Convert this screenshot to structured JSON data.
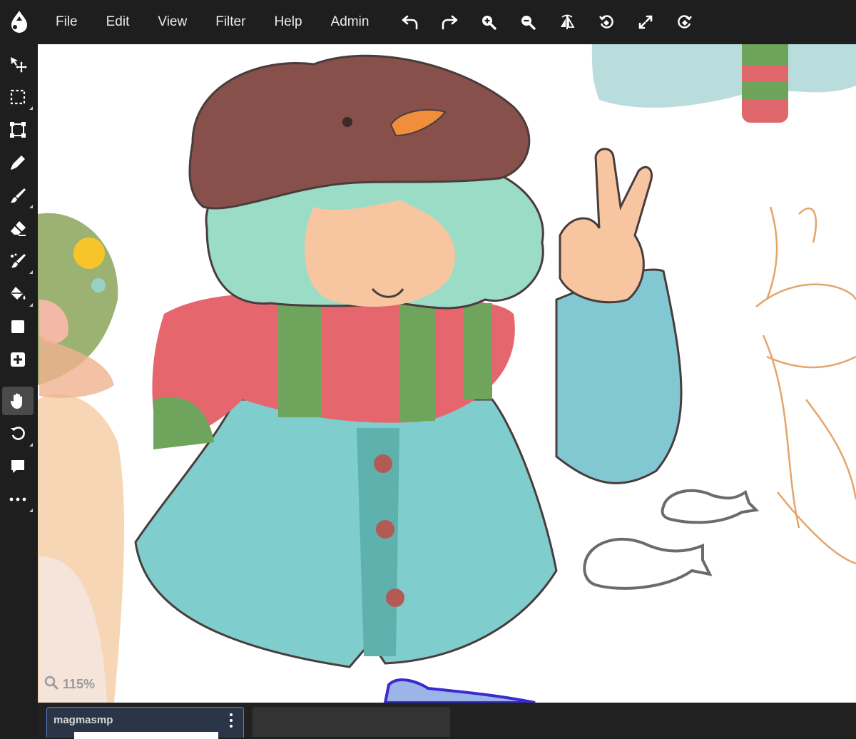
{
  "app": {
    "logo_icon": "droplet-logo-icon"
  },
  "menu": {
    "items": [
      "File",
      "Edit",
      "View",
      "Filter",
      "Help",
      "Admin"
    ]
  },
  "toolbar_top": {
    "buttons": [
      "undo-icon",
      "redo-icon",
      "zoom-in-icon",
      "zoom-out-icon",
      "flip-icon",
      "rotate-icon",
      "fullscreen-icon",
      "rotate-reset-icon"
    ]
  },
  "sidebar": {
    "tools": [
      {
        "icon": "select-move-icon",
        "sub": false
      },
      {
        "icon": "marquee-select-icon",
        "sub": true
      },
      {
        "icon": "transform-icon",
        "sub": false
      },
      {
        "icon": "pen-icon",
        "sub": false
      },
      {
        "icon": "brush-icon",
        "sub": true
      },
      {
        "icon": "eraser-icon",
        "sub": false
      },
      {
        "icon": "smudge-icon",
        "sub": true
      },
      {
        "icon": "fill-bucket-icon",
        "sub": true
      },
      {
        "icon": "shape-square-icon",
        "sub": false
      },
      {
        "icon": "add-layer-icon",
        "sub": false
      },
      {
        "icon": "hand-pan-icon",
        "sub": false,
        "active": true
      },
      {
        "icon": "rotate-tool-icon",
        "sub": true
      },
      {
        "icon": "speech-bubble-icon",
        "sub": false
      },
      {
        "icon": "more-icon",
        "sub": true
      }
    ]
  },
  "canvas": {
    "zoom_label": "115%"
  },
  "bottom": {
    "tabs": [
      {
        "title": "magmasmp",
        "active": true
      },
      {
        "title": "",
        "active": false
      }
    ]
  },
  "colors": {
    "bg": "#1e1e1e",
    "canvas": "#ffffff",
    "tab_active": "#2a3548",
    "tab_border": "#5b7bd0"
  }
}
